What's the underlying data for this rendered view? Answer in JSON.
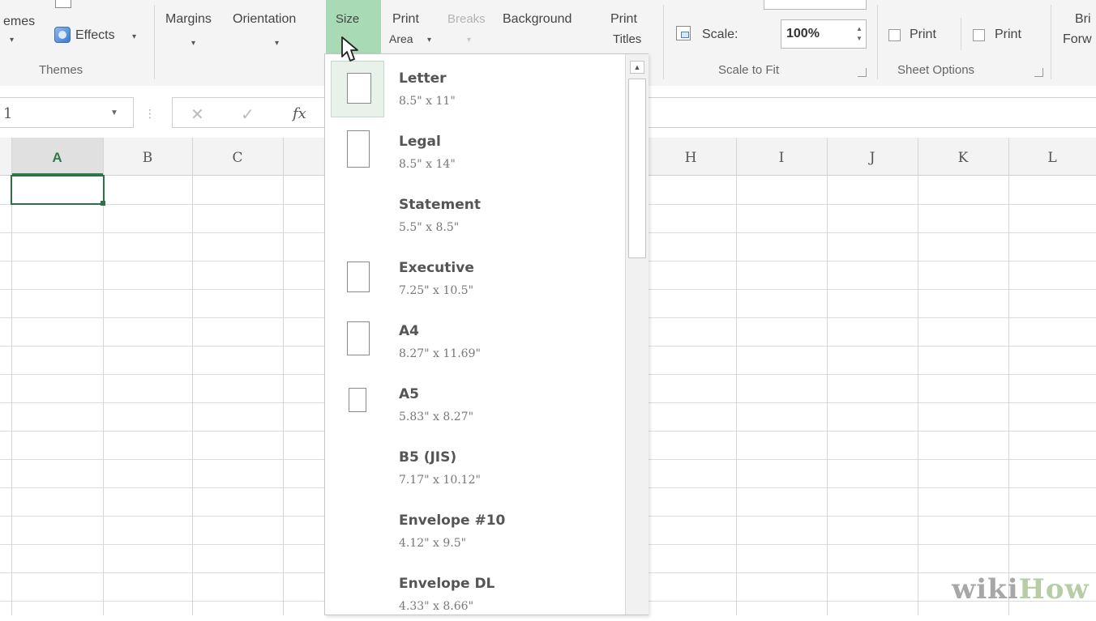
{
  "ribbon": {
    "themes_partial": "emes",
    "themes_caret": "▾",
    "effects_label": "Effects",
    "effects_caret": "▾",
    "themes_group_label": "Themes",
    "margins_label": "Margins",
    "orientation_label": "Orientation",
    "size_label": "Size",
    "print_area_line1": "Print",
    "print_area_line2": "Area",
    "print_area_caret": "▾",
    "breaks_label": "Breaks",
    "background_label": "Background",
    "print_titles_line1": "Print",
    "print_titles_line2": "Titles",
    "scale_label": "Scale:",
    "scale_value": "100%",
    "scale_group_label": "Scale to Fit",
    "print_gridlines_label": "Print",
    "print_headings_label": "Print",
    "sheet_options_label": "Sheet Options",
    "bring_forward_line1": "Bri",
    "bring_forward_line2": "Forw"
  },
  "formula_bar": {
    "name_box_value": "1",
    "cancel_symbol": "✕",
    "enter_symbol": "✓",
    "fx_label": "fx",
    "formula_value": ""
  },
  "grid": {
    "columns": [
      "A",
      "B",
      "C",
      "H",
      "I",
      "J",
      "K",
      "L"
    ],
    "active_column": "A"
  },
  "size_dropdown": {
    "options": [
      {
        "name": "Letter",
        "dim": "8.5\" x 11\"",
        "selected": true
      },
      {
        "name": "Legal",
        "dim": "8.5\" x 14\""
      },
      {
        "name": "Statement",
        "dim": "5.5\" x 8.5\""
      },
      {
        "name": "Executive",
        "dim": "7.25\" x 10.5\""
      },
      {
        "name": "A4",
        "dim": "8.27\" x 11.69\""
      },
      {
        "name": "A5",
        "dim": "5.83\" x 8.27\""
      },
      {
        "name": "B5 (JIS)",
        "dim": "7.17\" x 10.12\""
      },
      {
        "name": "Envelope #10",
        "dim": "4.12\" x 9.5\""
      },
      {
        "name": "Envelope DL",
        "dim": "4.33\" x 8.66\""
      }
    ]
  },
  "watermark": {
    "part1": "wiki",
    "part2": "How"
  },
  "colors": {
    "accent_green": "#2f6f45",
    "size_button_highlight": "#a9dab6",
    "watermark_gray": "#a7a7a7",
    "watermark_green": "#b6cda6"
  }
}
